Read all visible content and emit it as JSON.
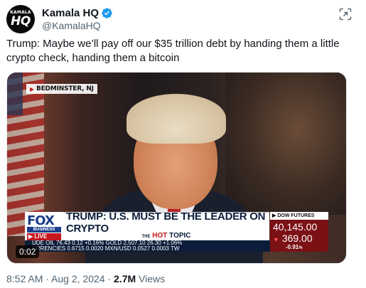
{
  "author": {
    "avatar_text_top": "KAMALA",
    "avatar_text_main": "HQ",
    "display_name": "Kamala HQ",
    "handle": "@KamalaHQ",
    "verified_icon": "verified-badge-icon",
    "brand_color": "#1d9bf0"
  },
  "tweet": {
    "text": "Trump: Maybe we’ll pay off our $35 trillion debt by handing them a little crypto check, handing them a bitcoin"
  },
  "video": {
    "location_tag": "BEDMINSTER, NJ",
    "channel_logo": "FOX",
    "channel_sub": "BUSINESS",
    "live_label": "LIVE",
    "headline": "TRUMP: U.S. MUST BE THE LEADER ON CRYPTO",
    "hot_topic_the": "THE",
    "hot_topic_hot": "HOT",
    "hot_topic_topic": "TOPIC",
    "dow_label": "DOW FUTURES",
    "dow_value": "40,145.00",
    "dow_change": "369.00",
    "dow_pct": "-0.91",
    "ticker_row1": "UDE OIL  76.43  0.12  +0.16%  GOLD  2,507.10  26.30  +1.06%",
    "ticker_row2": "URRENCIES  0.6715  0.0020  MXN/USD  0.0527  0.0003  TW",
    "time_badge": "0:02"
  },
  "meta": {
    "time": "8:52 AM",
    "date": "Aug 2, 2024",
    "separator": " · ",
    "views_count": "2.7M",
    "views_label": " Views"
  }
}
